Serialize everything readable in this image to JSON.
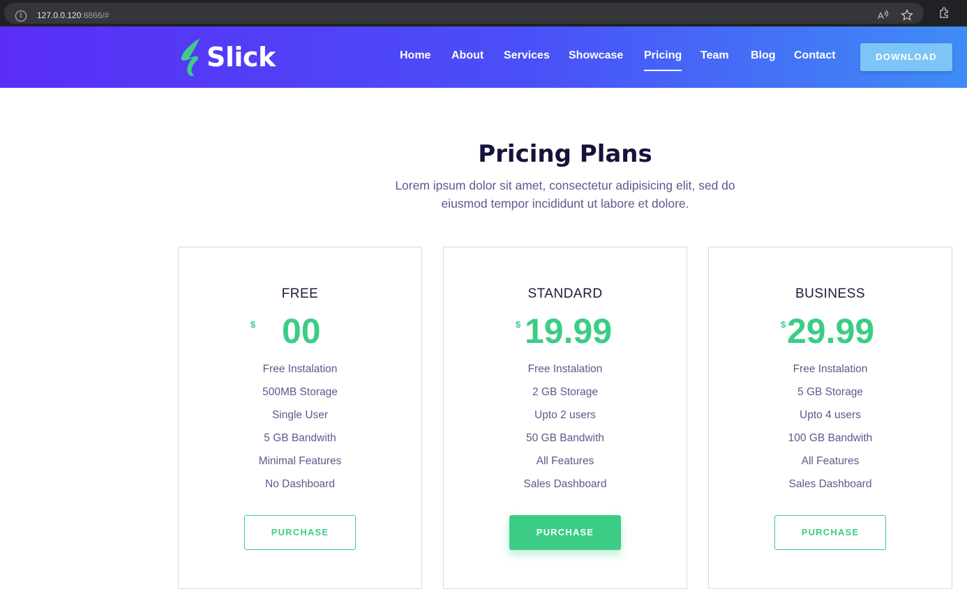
{
  "browser": {
    "url_host": "127.0.0.120",
    "url_rest": ":8866/#",
    "icons": [
      "info-icon",
      "read-aloud-icon",
      "favorite-star-icon",
      "extensions-icon"
    ]
  },
  "navbar": {
    "brand": "Slick",
    "logo_icon": "lightning-bolt-icon",
    "items": [
      {
        "label": "Home"
      },
      {
        "label": "About"
      },
      {
        "label": "Services"
      },
      {
        "label": "Showcase"
      },
      {
        "label": "Pricing",
        "active": true
      },
      {
        "label": "Team"
      },
      {
        "label": "Blog"
      },
      {
        "label": "Contact"
      }
    ],
    "download_label": "DOWNLOAD"
  },
  "section": {
    "title": "Pricing Plans",
    "subtitle": "Lorem ipsum dolor sit amet, consectetur adipisicing elit, sed do eiusmod tempor incididunt ut labore et dolore."
  },
  "plans": [
    {
      "name": "FREE",
      "currency": "$",
      "price": "00",
      "features": [
        "Free Instalation",
        "500MB Storage",
        "Single User",
        "5 GB Bandwith",
        "Minimal Features",
        "No Dashboard"
      ],
      "button_label": "PURCHASE",
      "highlighted": false
    },
    {
      "name": "STANDARD",
      "currency": "$",
      "price": "19.99",
      "features": [
        "Free Instalation",
        "2 GB Storage",
        "Upto 2 users",
        "50 GB Bandwith",
        "All Features",
        "Sales Dashboard"
      ],
      "button_label": "PURCHASE",
      "highlighted": true
    },
    {
      "name": "BUSINESS",
      "currency": "$",
      "price": "29.99",
      "features": [
        "Free Instalation",
        "5 GB Storage",
        "Upto 4 users",
        "100 GB Bandwith",
        "All Features",
        "Sales Dashboard"
      ],
      "button_label": "PURCHASE",
      "highlighted": false
    }
  ],
  "colors": {
    "accent_green": "#3ccc86",
    "nav_gradient_start": "#5a2df7",
    "nav_gradient_end": "#3f8cf6",
    "download_button": "#7dc4f7",
    "heading": "#15133a",
    "body_text": "#5a5a8c"
  }
}
